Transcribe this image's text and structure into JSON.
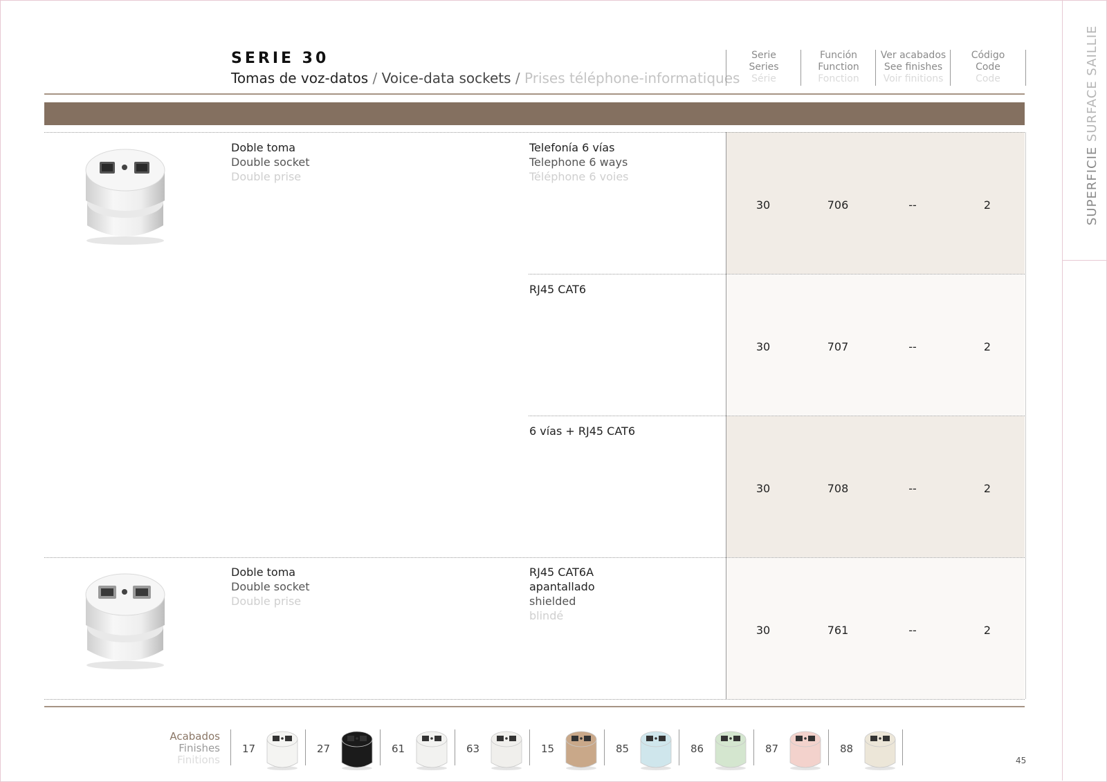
{
  "side_label": {
    "part1": "SUPERFICIE ",
    "part2": "SURFACE SAILLIE"
  },
  "header": {
    "series_title": "SERIE 30",
    "subtitle_es": "Tomas de voz-datos",
    "subtitle_en": "Voice-data sockets",
    "subtitle_fr": "Prises téléphone-informatiques",
    "separator": " / "
  },
  "columns": [
    {
      "es": "Serie",
      "en": "Series",
      "fr": "Série"
    },
    {
      "es": "Función",
      "en": "Function",
      "fr": "Fonction"
    },
    {
      "es": "Ver acabados",
      "en": "See finishes",
      "fr": "Voir finitions"
    },
    {
      "es": "Código",
      "en": "Code",
      "fr": "Code"
    }
  ],
  "products": [
    {
      "name_es": "Doble toma",
      "name_en": "Double socket",
      "name_fr": "Double prise",
      "variants": [
        {
          "desc": [
            "Telefonía 6 vías",
            "Telephone 6 ways",
            "Téléphone 6 voies"
          ],
          "serie": "30",
          "function": "706",
          "finishes": "--",
          "code": "2"
        },
        {
          "desc": [
            "RJ45 CAT6",
            "",
            ""
          ],
          "serie": "30",
          "function": "707",
          "finishes": "--",
          "code": "2"
        },
        {
          "desc": [
            "6 vías + RJ45 CAT6",
            "",
            ""
          ],
          "serie": "30",
          "function": "708",
          "finishes": "--",
          "code": "2"
        }
      ]
    },
    {
      "name_es": "Doble toma",
      "name_en": "Double socket",
      "name_fr": "Double prise",
      "variants": [
        {
          "desc": [
            "RJ45 CAT6A",
            "apantallado",
            "shielded",
            "blindé"
          ],
          "serie": "30",
          "function": "761",
          "finishes": "--",
          "code": "2"
        }
      ]
    }
  ],
  "finishes": {
    "label_es": "Acabados",
    "label_en": "Finishes",
    "label_fr": "Finitions",
    "items": [
      {
        "code": "17",
        "color": "#f4f4f2"
      },
      {
        "code": "27",
        "color": "#1b1b1b"
      },
      {
        "code": "61",
        "color": "#f2f2f0"
      },
      {
        "code": "63",
        "color": "#f0efec"
      },
      {
        "code": "15",
        "color": "#c9a889"
      },
      {
        "code": "85",
        "color": "#cfe6ec"
      },
      {
        "code": "86",
        "color": "#d4e6cf"
      },
      {
        "code": "87",
        "color": "#f3d2cc"
      },
      {
        "code": "88",
        "color": "#ece6d8"
      }
    ]
  },
  "page_number": "45"
}
